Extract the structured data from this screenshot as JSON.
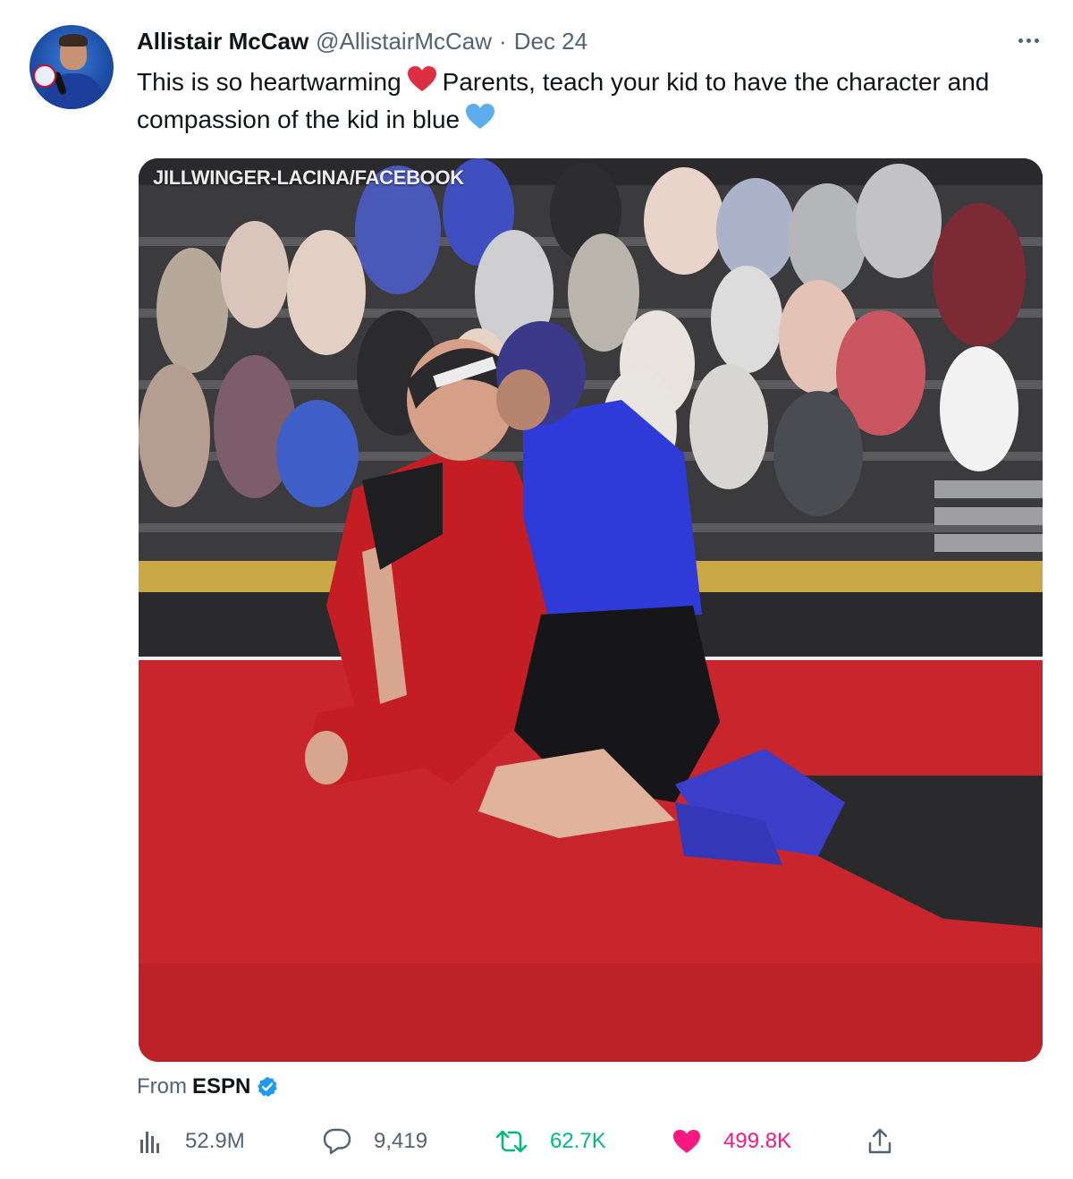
{
  "tweet": {
    "author_name": "Allistair McCaw",
    "handle": "@AllistairMcCaw",
    "separator": "·",
    "date": "Dec 24",
    "text_part1": "This is so heartwarming",
    "text_part2": "Parents, teach your kid to have the character and compassion of the kid in blue",
    "emoji_1": "red-heart-icon",
    "emoji_2": "blue-heart-icon"
  },
  "media": {
    "watermark": "JILLWINGER-LACINA/FACEBOOK"
  },
  "source": {
    "prefix": "From",
    "name": "ESPN"
  },
  "metrics": {
    "views": "52.9M",
    "replies": "9,419",
    "retweets": "62.7K",
    "likes": "499.8K"
  },
  "colors": {
    "retweet": "#00ba7c",
    "like": "#f91880",
    "verified": "#1d9bf0",
    "muted": "#536471"
  }
}
